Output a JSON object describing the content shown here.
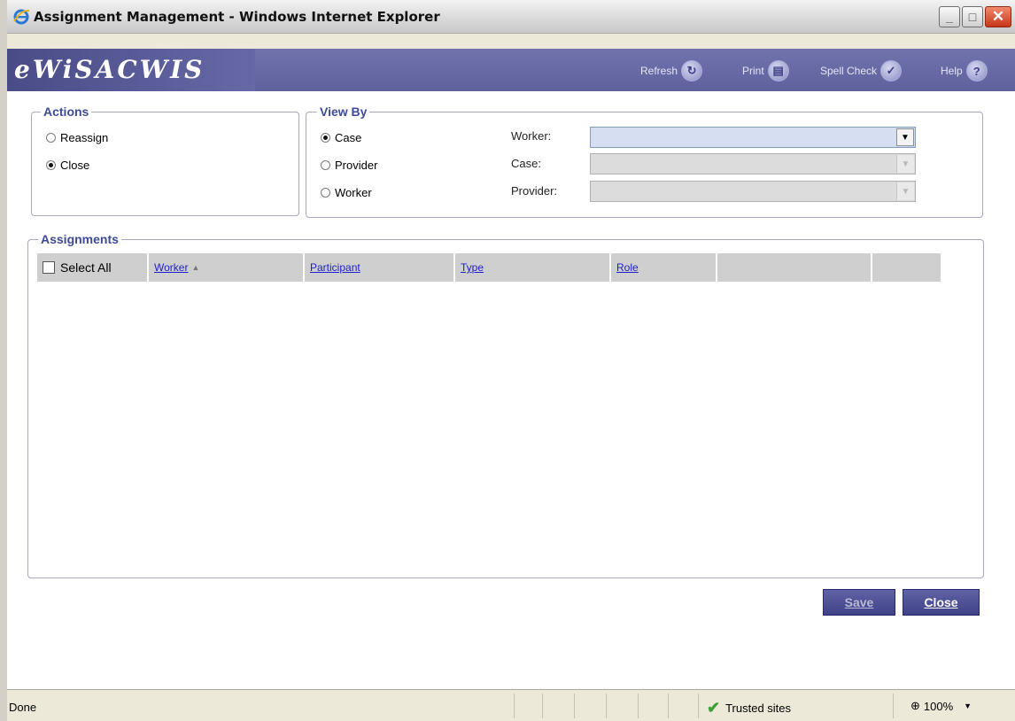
{
  "window": {
    "title": "Assignment Management - Windows Internet Explorer"
  },
  "app": {
    "logo": "eWiSACWIS",
    "toolbar": {
      "refresh": "Refresh",
      "print": "Print",
      "spell_check": "Spell Check",
      "help": "Help"
    }
  },
  "actions": {
    "legend": "Actions",
    "options": [
      {
        "label": "Reassign",
        "checked": false
      },
      {
        "label": "Close",
        "checked": true
      }
    ]
  },
  "view_by": {
    "legend": "View By",
    "options": [
      {
        "label": "Case",
        "checked": true
      },
      {
        "label": "Provider",
        "checked": false
      },
      {
        "label": "Worker",
        "checked": false
      }
    ],
    "fields": {
      "worker": "Worker:",
      "case": "Case:",
      "provider": "Provider:"
    }
  },
  "assignments": {
    "legend": "Assignments",
    "select_all": "Select All",
    "columns": [
      "Worker",
      "Participant",
      "Type",
      "Role"
    ]
  },
  "buttons": {
    "save": "Save",
    "close": "Close"
  },
  "statusbar": {
    "status": "Done",
    "zone": "Trusted sites",
    "zoom": "100%"
  }
}
